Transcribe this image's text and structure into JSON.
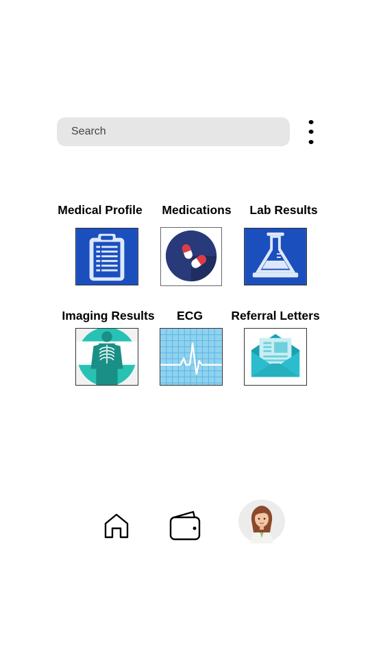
{
  "search": {
    "placeholder": "Search"
  },
  "menu": {
    "icon": "more-vertical-icon"
  },
  "grid": {
    "items": [
      {
        "label": "Medical Profile",
        "icon": "clipboard-icon",
        "color": "#1b4fbd"
      },
      {
        "label": "Medications",
        "icon": "pills-icon",
        "color": "#283a7a"
      },
      {
        "label": "Lab Results",
        "icon": "flask-icon",
        "color": "#1b4fbd"
      },
      {
        "label": "Imaging Results",
        "icon": "xray-icon",
        "color": "#27c2b4"
      },
      {
        "label": "ECG",
        "icon": "ecg-icon",
        "color": "#8fd2f0"
      },
      {
        "label": "Referral Letters",
        "icon": "envelope-icon",
        "color": "#25b8c8"
      }
    ]
  },
  "bottom_nav": {
    "items": [
      {
        "icon": "home-icon"
      },
      {
        "icon": "wallet-icon"
      },
      {
        "icon": "avatar"
      }
    ]
  }
}
